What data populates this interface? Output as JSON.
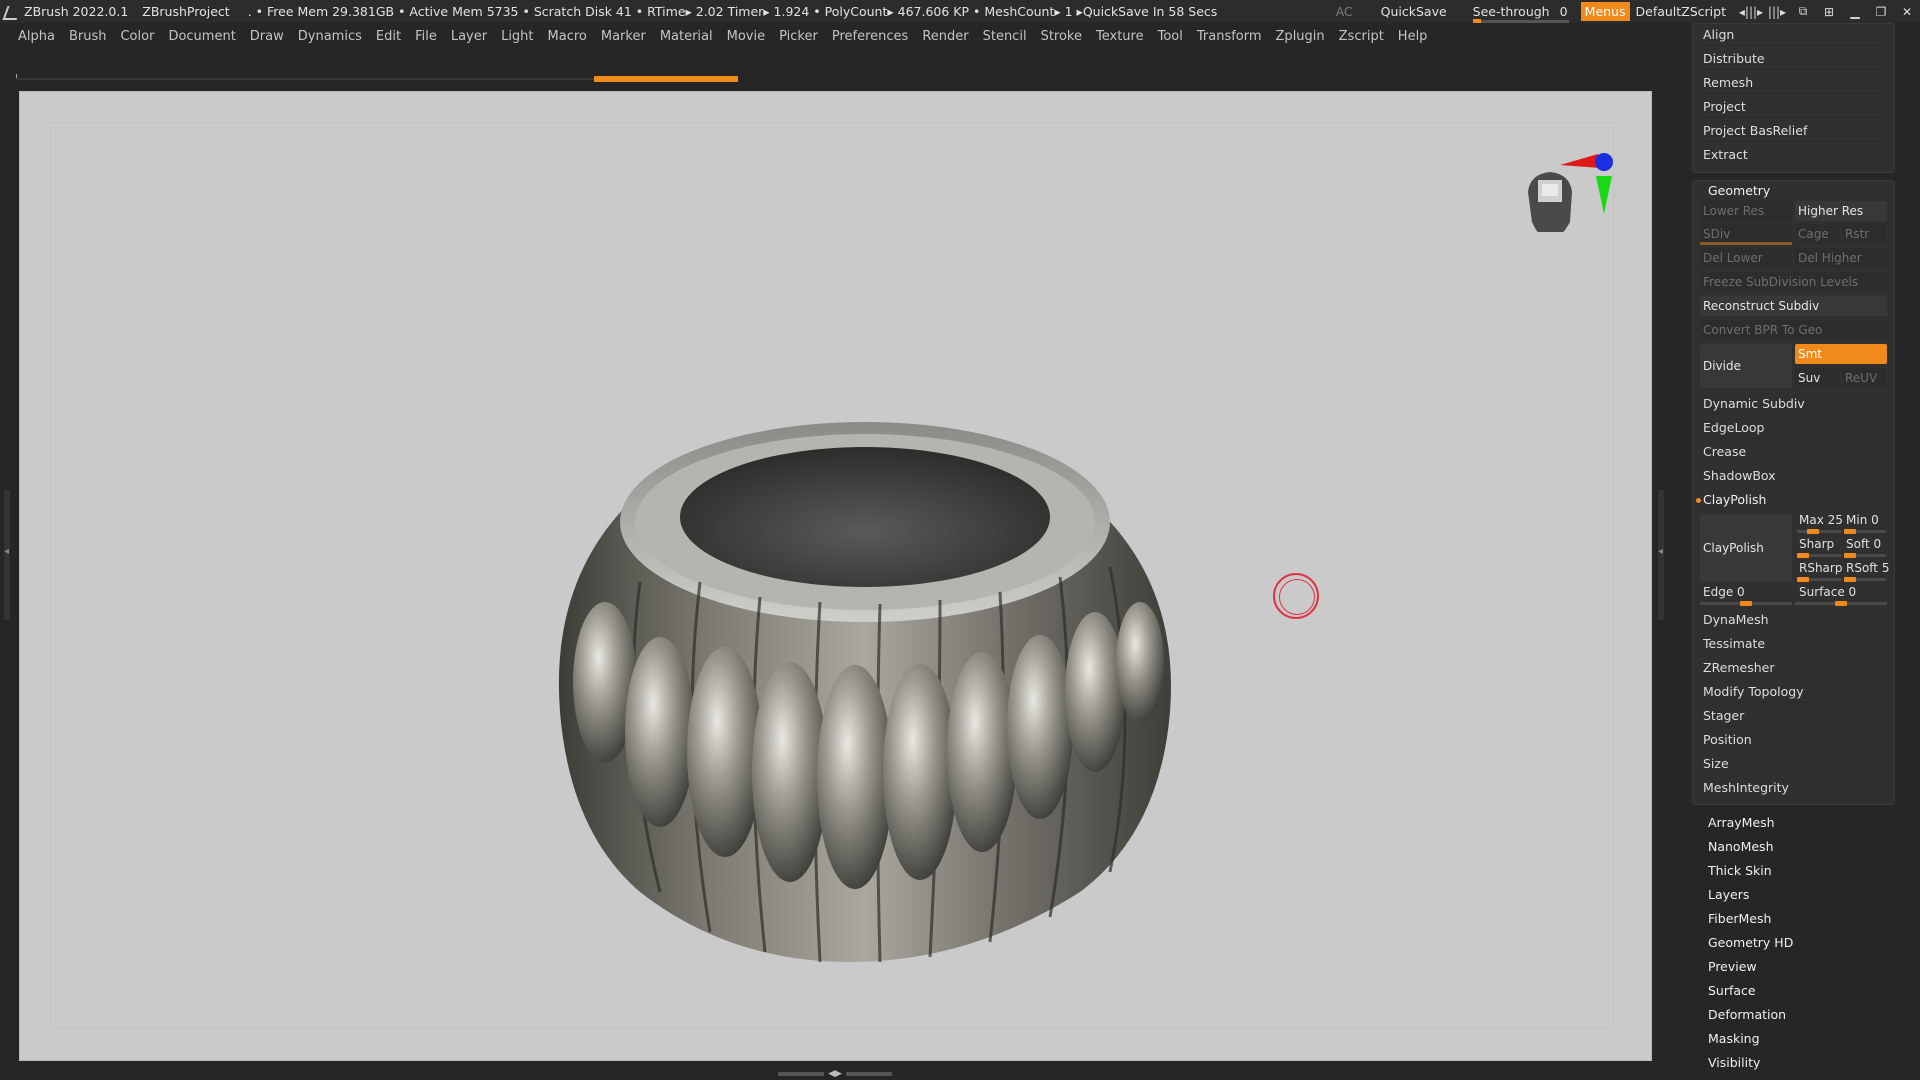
{
  "titlebar": {
    "app": "ZBrush 2022.0.1",
    "project": "ZBrushProject",
    "stats": ". • Free Mem 29.381GB • Active Mem 5735 • Scratch Disk 41 • RTime▸ 2.02 Timer▸ 1.924 • PolyCount▸ 467.606 KP • MeshCount▸ 1 ▸QuickSave In 58 Secs",
    "ac": "AC",
    "quicksave": "QuickSave",
    "see_through": "See-through",
    "see_through_value": "0",
    "menus": "Menus",
    "default_script": "DefaultZScript"
  },
  "menu": [
    "Alpha",
    "Brush",
    "Color",
    "Document",
    "Draw",
    "Dynamics",
    "Edit",
    "File",
    "Layer",
    "Light",
    "Macro",
    "Marker",
    "Material",
    "Movie",
    "Picker",
    "Preferences",
    "Render",
    "Stencil",
    "Stroke",
    "Texture",
    "Tool",
    "Transform",
    "Zplugin",
    "Zscript",
    "Help"
  ],
  "panel": {
    "top_items": [
      "Align",
      "Distribute",
      "Remesh",
      "Project",
      "Project BasRelief",
      "Extract"
    ],
    "geometry": {
      "title": "Geometry",
      "lower_res": "Lower Res",
      "higher_res": "Higher Res",
      "sdiv": "SDiv",
      "cage": "Cage",
      "rstr": "Rstr",
      "del_lower": "Del Lower",
      "del_higher": "Del Higher",
      "freeze": "Freeze SubDivision Levels",
      "reconstruct": "Reconstruct Subdiv",
      "convert_bpr": "Convert BPR To Geo",
      "divide": "Divide",
      "smt": "Smt",
      "suv": "Suv",
      "reuv": "ReUV",
      "items_a": [
        "Dynamic Subdiv",
        "EdgeLoop",
        "Crease",
        "ShadowBox"
      ],
      "claypolish_header": "ClayPolish",
      "claypolish_btn": "ClayPolish",
      "max": "Max 25",
      "min": "Min 0",
      "sharp": "Sharp",
      "sharp_val": "",
      "soft": "Soft 0",
      "rsharp": "RSharp",
      "rsoft": "RSoft 5",
      "edge": "Edge 0",
      "surface": "Surface 0",
      "items_b": [
        "DynaMesh",
        "Tessimate",
        "ZRemesher",
        "Modify Topology",
        "Stager",
        "Position",
        "Size",
        "MeshIntegrity"
      ]
    },
    "sub_items": [
      "ArrayMesh",
      "NanoMesh",
      "Thick Skin",
      "Layers",
      "FiberMesh",
      "Geometry HD",
      "Preview",
      "Surface",
      "Deformation",
      "Masking",
      "Visibility"
    ]
  },
  "colors": {
    "accent": "#f28a1b",
    "viewport_bg": "#cacaca",
    "panel_bg": "#262626"
  }
}
